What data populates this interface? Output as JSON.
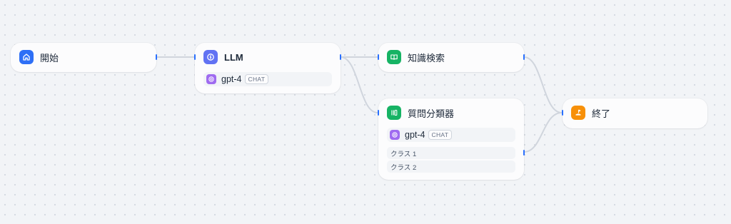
{
  "colors": {
    "start": "#2e6ff6",
    "llm": "#6172f3",
    "knowledge": "#16b364",
    "classifier": "#16b364",
    "end": "#f79009",
    "model": "#9f6bf0",
    "edge": "#d0d5dd",
    "handle": "#2970ff"
  },
  "nodes": {
    "start": {
      "title": "開始",
      "icon": "home-icon"
    },
    "llm": {
      "title": "LLM",
      "icon": "llm-icon",
      "model": {
        "name": "gpt-4",
        "badge": "CHAT",
        "icon": "openai-icon"
      }
    },
    "knowledge": {
      "title": "知識検索",
      "icon": "book-icon"
    },
    "classifier": {
      "title": "質問分類器",
      "icon": "classifier-icon",
      "model": {
        "name": "gpt-4",
        "badge": "CHAT",
        "icon": "openai-icon"
      },
      "classes": [
        "クラス 1",
        "クラス 2"
      ]
    },
    "end": {
      "title": "終了",
      "icon": "end-flag-icon"
    }
  }
}
